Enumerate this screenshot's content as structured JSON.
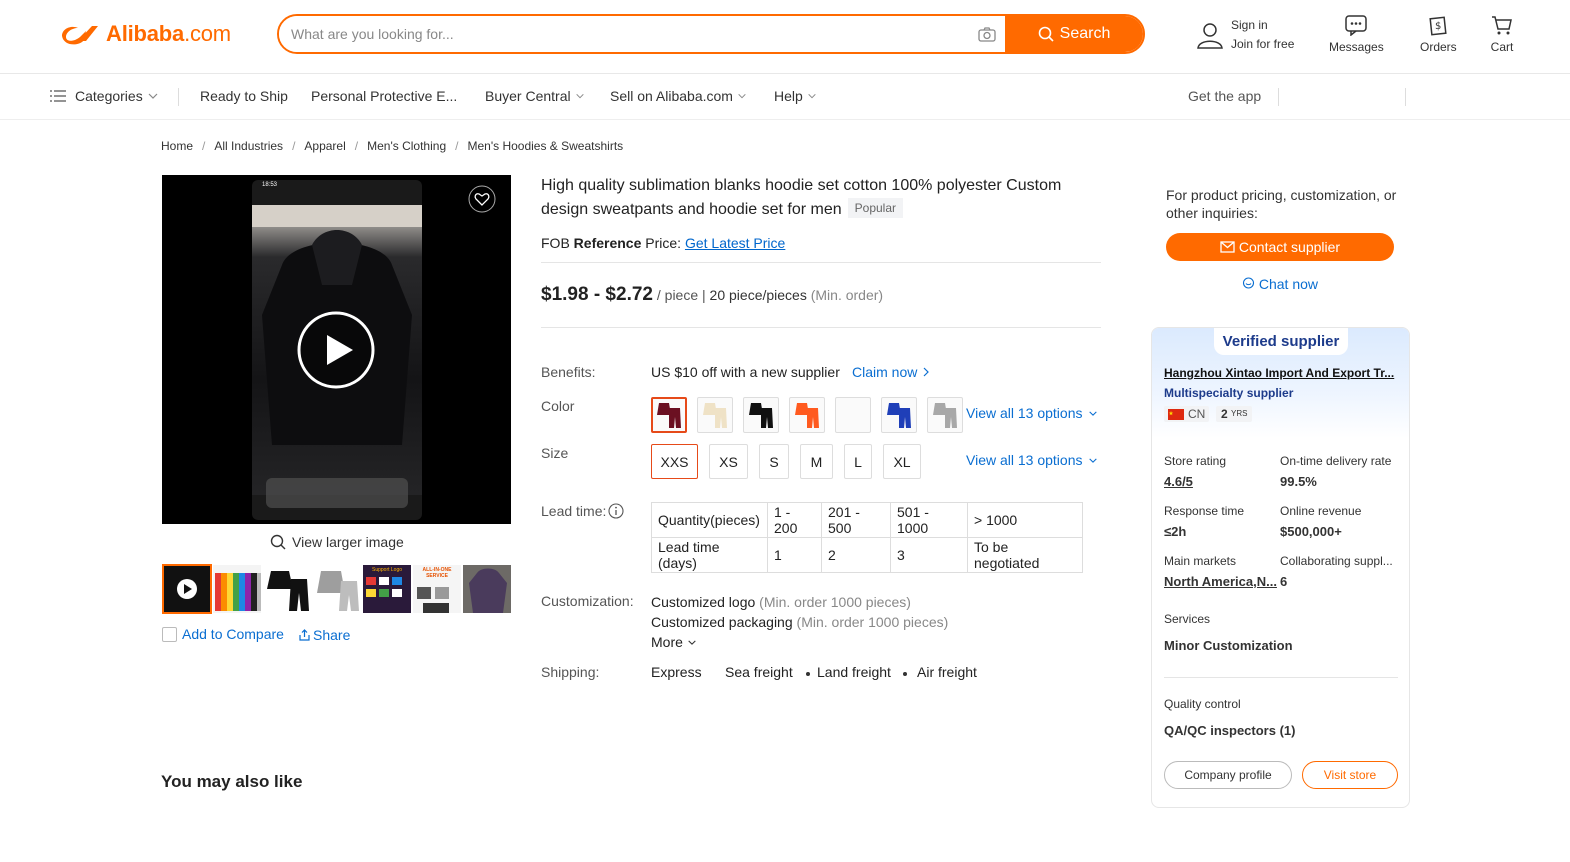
{
  "header": {
    "logo_text": "Alibaba",
    "logo_dot": ".com",
    "search_placeholder": "What are you looking for...",
    "search_button": "Search",
    "sign_in": "Sign in",
    "join": "Join for free",
    "messages": "Messages",
    "orders": "Orders",
    "cart": "Cart"
  },
  "nav": {
    "categories": "Categories",
    "ready_to_ship": "Ready to Ship",
    "ppe": "Personal Protective E...",
    "buyer_central": "Buyer Central",
    "sell": "Sell on Alibaba.com",
    "help": "Help",
    "get_app": "Get the app"
  },
  "breadcrumb": [
    "Home",
    "All Industries",
    "Apparel",
    "Men's Clothing",
    "Men's Hoodies & Sweatshirts"
  ],
  "gallery": {
    "view_larger": "View larger image",
    "add_compare": "Add to Compare",
    "share": "Share",
    "phone_time": "18:53",
    "thumb_text_1": "Support Logo",
    "thumb_text_2": "ALL-IN-ONE SERVICE"
  },
  "product": {
    "title": "High quality sublimation blanks hoodie set cotton 100% polyester Custom design sweatpants and hoodie set for men",
    "popular_badge": "Popular",
    "fob_prefix": "FOB",
    "fob_reference": "Reference",
    "fob_price_label": "Price:",
    "fob_link": "Get Latest Price",
    "price_range": "$1.98 - $2.72",
    "price_unit": "/ piece |",
    "moq": "20 piece/pieces",
    "moq_note": "(Min. order)",
    "benefits_label": "Benefits:",
    "benefits_text": "US $10 off with a new supplier",
    "claim_now": "Claim now",
    "color_label": "Color",
    "colors": [
      "#6b1022",
      "#efe2c6",
      "#111111",
      "#ff5a1f",
      "#ffffff",
      "#1f3fb8",
      "#a8a8a8"
    ],
    "view_all_colors": "View all 13 options",
    "size_label": "Size",
    "sizes": [
      "XXS",
      "XS",
      "S",
      "M",
      "L",
      "XL"
    ],
    "view_all_sizes": "View all 13 options",
    "lead_time_label": "Lead time:",
    "lead_table": {
      "row1": [
        "Quantity(pieces)",
        "1 - 200",
        "201 - 500",
        "501 - 1000",
        "> 1000"
      ],
      "row2": [
        "Lead time (days)",
        "1",
        "2",
        "3",
        "To be negotiated"
      ]
    },
    "customization_label": "Customization:",
    "custom_logo": "Customized logo",
    "custom_logo_note": "(Min. order 1000 pieces)",
    "custom_packaging": "Customized packaging",
    "custom_packaging_note": "(Min. order 1000 pieces)",
    "more": "More",
    "shipping_label": "Shipping:",
    "shipping": [
      "Express",
      "Sea freight",
      "Land freight",
      "Air freight"
    ]
  },
  "supplier": {
    "inquiry_text": "For product pricing, customization, or other inquiries:",
    "contact_button": "Contact supplier",
    "chat_now": "Chat now",
    "verified_label": "Verified supplier",
    "name": "Hangzhou Xintao Import And Export Tr...",
    "type": "Multispecialty supplier",
    "country": "CN",
    "years": "2",
    "years_unit": "YRS",
    "store_rating_label": "Store rating",
    "store_rating": "4.6/5",
    "ontime_label": "On-time delivery rate",
    "ontime": "99.5%",
    "response_label": "Response time",
    "response": "≤2h",
    "revenue_label": "Online revenue",
    "revenue": "$500,000+",
    "markets_label": "Main markets",
    "markets": "North America,N...",
    "collab_label": "Collaborating suppl...",
    "collab": "6",
    "services_label": "Services",
    "services": "Minor Customization",
    "qc_label": "Quality control",
    "qc": "QA/QC inspectors (1)",
    "company_profile": "Company profile",
    "visit_store": "Visit store"
  },
  "section": {
    "you_may_also_like": "You may also like"
  }
}
